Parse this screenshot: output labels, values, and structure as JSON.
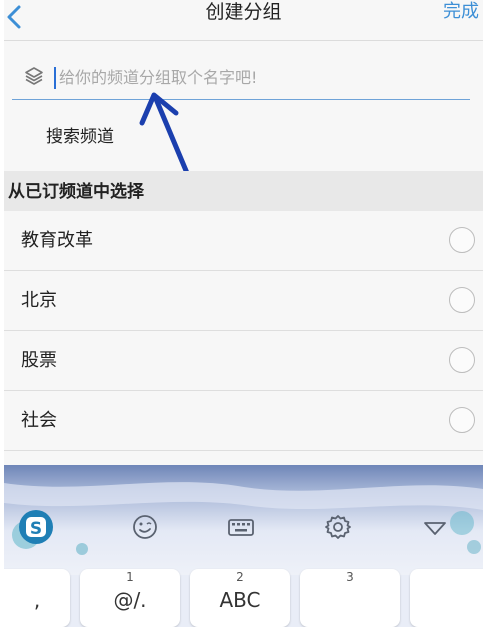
{
  "header": {
    "title": "创建分组",
    "done_label": "完成"
  },
  "name_input": {
    "placeholder": "给你的频道分组取个名字吧!"
  },
  "search_channel_label": "搜索频道",
  "section": {
    "title": "从已订频道中选择"
  },
  "channels": [
    {
      "label": "教育改革",
      "selected": false
    },
    {
      "label": "北京",
      "selected": false
    },
    {
      "label": "股票",
      "selected": false
    },
    {
      "label": "社会",
      "selected": false
    }
  ],
  "keyboard": {
    "toolbar_icons": [
      "sogou-logo-icon",
      "emoji-icon",
      "keyboard-icon",
      "settings-gear-icon",
      "collapse-triangle-icon"
    ],
    "keys": [
      {
        "num": "",
        "main": ","
      },
      {
        "num": "1",
        "main": "@/."
      },
      {
        "num": "2",
        "main": "ABC"
      },
      {
        "num": "3",
        "main": ""
      },
      {
        "num": "",
        "main": ""
      }
    ]
  },
  "colors": {
    "accent": "#3d8fd6",
    "annotation_arrow": "#1b3fae",
    "input_underline": "#6fa3d8"
  }
}
